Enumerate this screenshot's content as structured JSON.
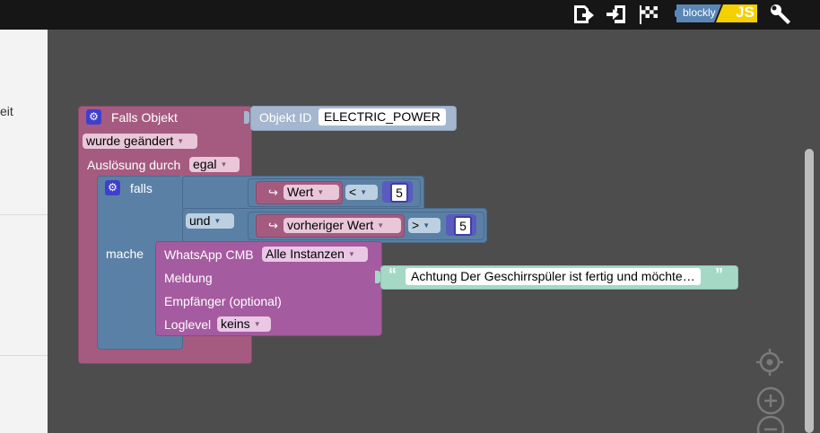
{
  "toolbar": {
    "icons": [
      "export-icon",
      "import-icon",
      "checkered-flag-icon",
      "blockly-js-toggle",
      "wrench-icon"
    ],
    "blockly_label": "blockly",
    "js_label": "JS"
  },
  "sidebar": {
    "truncated_text": "eit"
  },
  "colors": {
    "topbar": "#161616",
    "workspace": "#4d4d4d",
    "trigger_block": "#a55b80",
    "logic_block": "#5b80a5",
    "text_block": "#a5d9c6"
  },
  "blocks": {
    "trigger": {
      "title": "Falls Objekt",
      "object_label": "Objekt ID",
      "object_id": "ELECTRIC_POWER",
      "condition": "wurde geändert",
      "trigger_label": "Auslösung durch",
      "trigger_value": "egal"
    },
    "if": {
      "label": "falls",
      "and_label": "und",
      "do_label": "mache",
      "cond1": {
        "var": "Wert",
        "op": "<",
        "value": "5"
      },
      "cond2": {
        "var": "vorheriger Wert",
        "op": ">",
        "value": "5"
      }
    },
    "whatsapp": {
      "title": "WhatsApp CMB",
      "instance": "Alle Instanzen",
      "message_label": "Meldung",
      "message_text": "Achtung Der Geschirrspüler ist fertig und möchte…",
      "recipient_label": "Empfänger (optional)",
      "loglevel_label": "Loglevel",
      "loglevel_value": "keins"
    }
  }
}
